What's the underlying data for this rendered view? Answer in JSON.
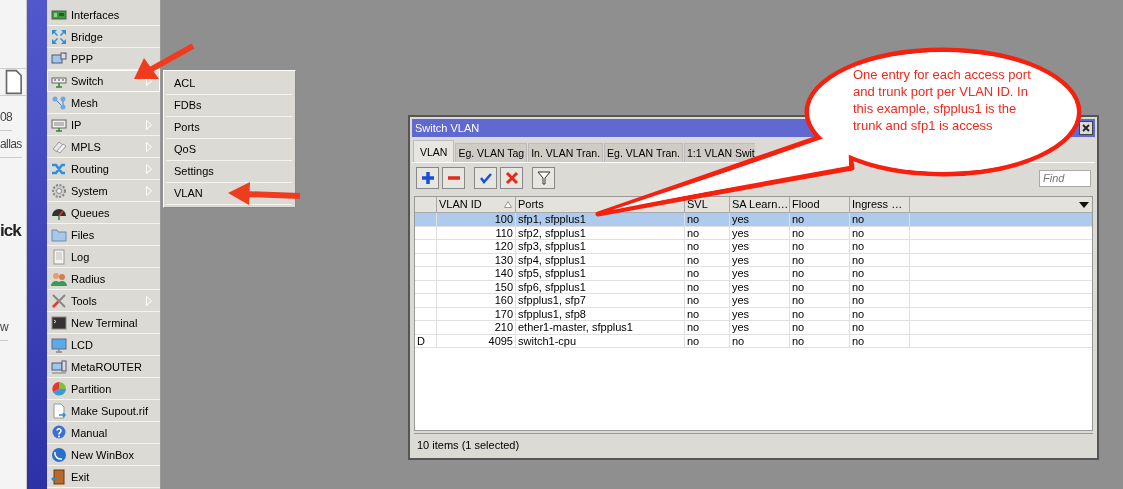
{
  "browser_strip": {
    "fragments": [
      {
        "text": "08",
        "kind": "plain"
      },
      {
        "text": "allas",
        "kind": "plain"
      },
      {
        "text": "ick",
        "kind": "heading"
      },
      {
        "text": "w",
        "kind": "plain"
      }
    ]
  },
  "menu": {
    "items": [
      {
        "label": "Interfaces",
        "has_submenu": false,
        "selected": false
      },
      {
        "label": "Bridge",
        "has_submenu": false,
        "selected": false
      },
      {
        "label": "PPP",
        "has_submenu": false,
        "selected": false
      },
      {
        "label": "Switch",
        "has_submenu": true,
        "selected": true
      },
      {
        "label": "Mesh",
        "has_submenu": false,
        "selected": false
      },
      {
        "label": "IP",
        "has_submenu": true,
        "selected": false
      },
      {
        "label": "MPLS",
        "has_submenu": true,
        "selected": false
      },
      {
        "label": "Routing",
        "has_submenu": true,
        "selected": false
      },
      {
        "label": "System",
        "has_submenu": true,
        "selected": false
      },
      {
        "label": "Queues",
        "has_submenu": false,
        "selected": false
      },
      {
        "label": "Files",
        "has_submenu": false,
        "selected": false
      },
      {
        "label": "Log",
        "has_submenu": false,
        "selected": false
      },
      {
        "label": "Radius",
        "has_submenu": false,
        "selected": false
      },
      {
        "label": "Tools",
        "has_submenu": true,
        "selected": false
      },
      {
        "label": "New Terminal",
        "has_submenu": false,
        "selected": false
      },
      {
        "label": "LCD",
        "has_submenu": false,
        "selected": false
      },
      {
        "label": "MetaROUTER",
        "has_submenu": false,
        "selected": false
      },
      {
        "label": "Partition",
        "has_submenu": false,
        "selected": false
      },
      {
        "label": "Make Supout.rif",
        "has_submenu": false,
        "selected": false
      },
      {
        "label": "Manual",
        "has_submenu": false,
        "selected": false
      },
      {
        "label": "New WinBox",
        "has_submenu": false,
        "selected": false
      },
      {
        "label": "Exit",
        "has_submenu": false,
        "selected": false
      }
    ]
  },
  "submenu": {
    "items": [
      {
        "label": "ACL"
      },
      {
        "label": "FDBs"
      },
      {
        "label": "Ports"
      },
      {
        "label": "QoS"
      },
      {
        "label": "Settings"
      },
      {
        "label": "VLAN"
      }
    ]
  },
  "window": {
    "title": "Switch VLAN",
    "tabs": [
      {
        "label": "VLAN",
        "selected": true
      },
      {
        "label": "Eg. VLAN Tag",
        "selected": false
      },
      {
        "label": "In. VLAN Tran.",
        "selected": false
      },
      {
        "label": "Eg. VLAN Tran.",
        "selected": false
      },
      {
        "label": "1:1 VLAN Swit",
        "selected": false
      }
    ],
    "toolbar": [
      {
        "kind": "add"
      },
      {
        "kind": "remove"
      },
      {
        "kind": "enable"
      },
      {
        "kind": "disable"
      },
      {
        "kind": "filter"
      }
    ],
    "search": {
      "placeholder": "Find"
    },
    "table": {
      "columns": [
        {
          "sorted": false
        },
        {
          "label": "VLAN ID",
          "sorted": true
        },
        {
          "label": "Ports",
          "sorted": false
        },
        {
          "label": "SVL",
          "sorted": false
        },
        {
          "label": "SA Learn…",
          "sorted": false
        },
        {
          "label": "Flood",
          "sorted": false
        },
        {
          "label": "Ingress …",
          "sorted": false
        }
      ],
      "rows": [
        {
          "cells": [
            "",
            "100",
            "sfp1, sfpplus1",
            "no",
            "yes",
            "no",
            "no"
          ],
          "selected": true
        },
        {
          "cells": [
            "",
            "110",
            "sfp2, sfpplus1",
            "no",
            "yes",
            "no",
            "no"
          ],
          "selected": false
        },
        {
          "cells": [
            "",
            "120",
            "sfp3, sfpplus1",
            "no",
            "yes",
            "no",
            "no"
          ],
          "selected": false
        },
        {
          "cells": [
            "",
            "130",
            "sfp4, sfpplus1",
            "no",
            "yes",
            "no",
            "no"
          ],
          "selected": false
        },
        {
          "cells": [
            "",
            "140",
            "sfp5, sfpplus1",
            "no",
            "yes",
            "no",
            "no"
          ],
          "selected": false
        },
        {
          "cells": [
            "",
            "150",
            "sfp6, sfpplus1",
            "no",
            "yes",
            "no",
            "no"
          ],
          "selected": false
        },
        {
          "cells": [
            "",
            "160",
            "sfpplus1, sfp7",
            "no",
            "yes",
            "no",
            "no"
          ],
          "selected": false
        },
        {
          "cells": [
            "",
            "170",
            "sfpplus1, sfp8",
            "no",
            "yes",
            "no",
            "no"
          ],
          "selected": false
        },
        {
          "cells": [
            "",
            "210",
            "ether1-master, sfpplus1",
            "no",
            "yes",
            "no",
            "no"
          ],
          "selected": false
        },
        {
          "cells": [
            "D",
            "4095",
            "switch1-cpu",
            "no",
            "no",
            "no",
            "no"
          ],
          "selected": false
        }
      ]
    },
    "status_bar": "10 items (1 selected)"
  },
  "callout": {
    "text": "One entry for each access port and trunk port per VLAN ID. In this example, sfpplus1 is the trunk and sfp1 is access"
  }
}
